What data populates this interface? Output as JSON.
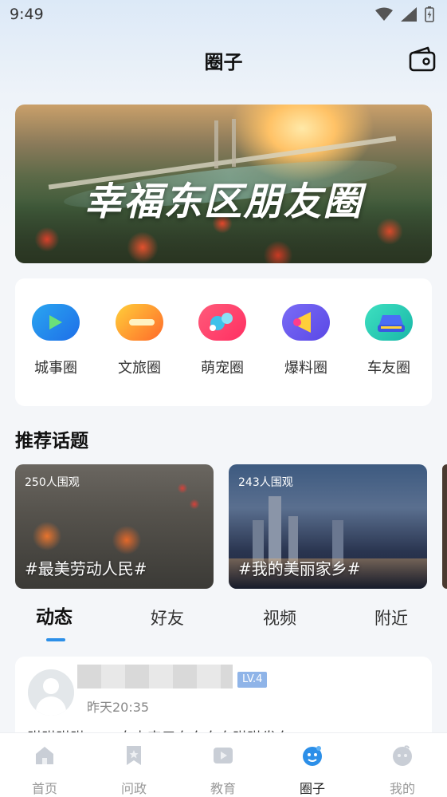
{
  "status_bar": {
    "time": "9:49"
  },
  "header": {
    "title": "圈子"
  },
  "banner": {
    "title": "幸福东区朋友圈"
  },
  "categories": [
    {
      "label": "城事圈"
    },
    {
      "label": "文旅圈"
    },
    {
      "label": "萌宠圈"
    },
    {
      "label": "爆料圈"
    },
    {
      "label": "车友圈"
    }
  ],
  "recommended": {
    "title": "推荐话题",
    "topics": [
      {
        "views": "250人围观",
        "name": "#最美劳动人民#"
      },
      {
        "views": "243人围观",
        "name": "#我的美丽家乡#"
      }
    ]
  },
  "tabs": [
    {
      "label": "动态",
      "active": true
    },
    {
      "label": "好友"
    },
    {
      "label": "视频"
    },
    {
      "label": "附近"
    }
  ],
  "post": {
    "level": "LV.4",
    "time": "昨天20:35",
    "preview": "琳琳琳琳…… 自由来元东东东东琳琳发东"
  },
  "bottom_nav": [
    {
      "label": "首页"
    },
    {
      "label": "问政"
    },
    {
      "label": "教育"
    },
    {
      "label": "圈子",
      "active": true
    },
    {
      "label": "我的"
    }
  ],
  "colors": {
    "accent": "#2c8fe8",
    "level_badge": "#8fb4e8"
  }
}
